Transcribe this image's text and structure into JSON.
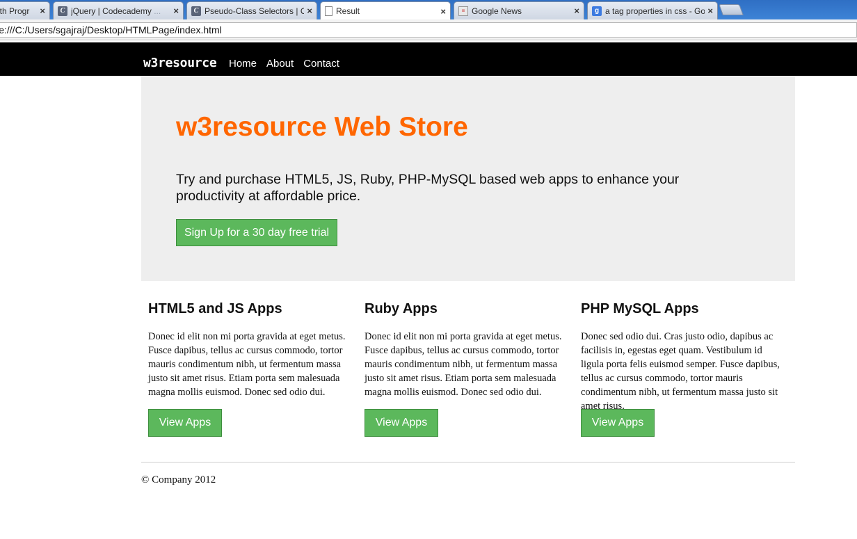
{
  "browser": {
    "tabs": [
      {
        "title": "ith Progr",
        "icon": "page-icon"
      },
      {
        "title": "jQuery | Codecademy",
        "fade": "...",
        "icon": "codecademy-icon"
      },
      {
        "title": "Pseudo-Class Selectors | C",
        "icon": "codecademy-icon"
      },
      {
        "title": "Result",
        "icon": "document-icon"
      },
      {
        "title": "Google News",
        "icon": "news-icon"
      },
      {
        "title": "a tag properties in css - Go",
        "icon": "google-icon"
      }
    ],
    "url": "ile:///C:/Users/sgajraj/Desktop/HTMLPage/index.html"
  },
  "navbar": {
    "brand": "w3resource",
    "links": [
      "Home",
      "About",
      "Contact"
    ]
  },
  "hero": {
    "title": "w3resource Web Store",
    "text": "Try and purchase HTML5, JS, Ruby, PHP-MySQL based web apps to enhance your productivity at affordable price.",
    "button": "Sign Up for a 30 day free trial",
    "title_color": "#ff6600",
    "background": "#eeeeee"
  },
  "columns": [
    {
      "heading": "HTML5 and JS Apps",
      "body": "Donec id elit non mi porta gravida at eget metus. Fusce dapibus, tellus ac cursus commodo, tortor mauris condimentum nibh, ut fermentum massa justo sit amet risus. Etiam porta sem malesuada magna mollis euismod. Donec sed odio dui.",
      "button": "View Apps"
    },
    {
      "heading": "Ruby Apps",
      "body": "Donec id elit non mi porta gravida at eget metus. Fusce dapibus, tellus ac cursus commodo, tortor mauris condimentum nibh, ut fermentum massa justo sit amet risus. Etiam porta sem malesuada magna mollis euismod. Donec sed odio dui.",
      "button": "View Apps"
    },
    {
      "heading": "PHP MySQL Apps",
      "body": "Donec sed odio dui. Cras justo odio, dapibus ac facilisis in, egestas eget quam. Vestibulum id ligula porta felis euismod semper. Fusce dapibus, tellus ac cursus commodo, tortor mauris condimentum nibh, ut fermentum massa justo sit amet risus.",
      "button": "View Apps"
    }
  ],
  "footer": {
    "text": "© Company 2012"
  },
  "colors": {
    "button_green": "#5cb85c",
    "navbar": "#000000"
  }
}
